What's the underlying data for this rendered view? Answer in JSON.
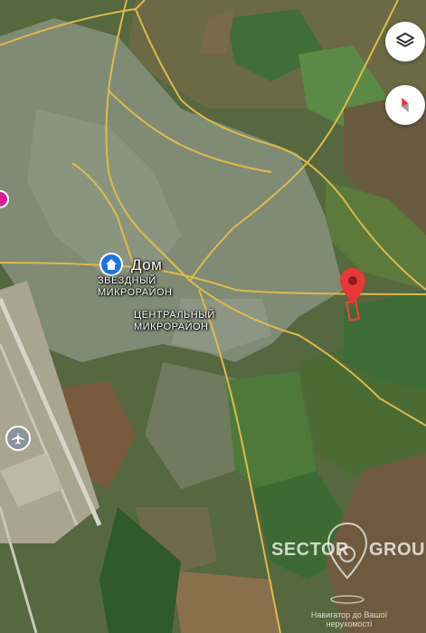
{
  "map": {
    "places": {
      "home": {
        "label": "Дом",
        "icon": "home-icon"
      },
      "district_zvezdny": [
        "ЗВЕЗДНЫЙ",
        "МИКРОРАЙОН"
      ],
      "district_central": [
        "ЦЕНТРАЛЬНЫЙ",
        "МИКРОРАЙОН"
      ]
    },
    "markers": {
      "target": {
        "icon": "location-pin-icon",
        "color": "#e53935"
      },
      "airport": {
        "icon": "airplane-icon"
      },
      "partial_poi": {
        "icon": "poi-icon",
        "color": "#d81b9c"
      }
    },
    "controls": {
      "layers": {
        "icon": "layers-icon"
      },
      "compass": {
        "icon": "compass-icon"
      }
    },
    "colors": {
      "road": "#e0b94a",
      "farmland": "#5f7d3e",
      "urban": "#7d8a72"
    }
  },
  "watermark": {
    "brand_left": "SECTOR",
    "brand_right": "GROUP",
    "caption_line1": "Навигатор до Вашої",
    "caption_line2": "нерухомості"
  }
}
